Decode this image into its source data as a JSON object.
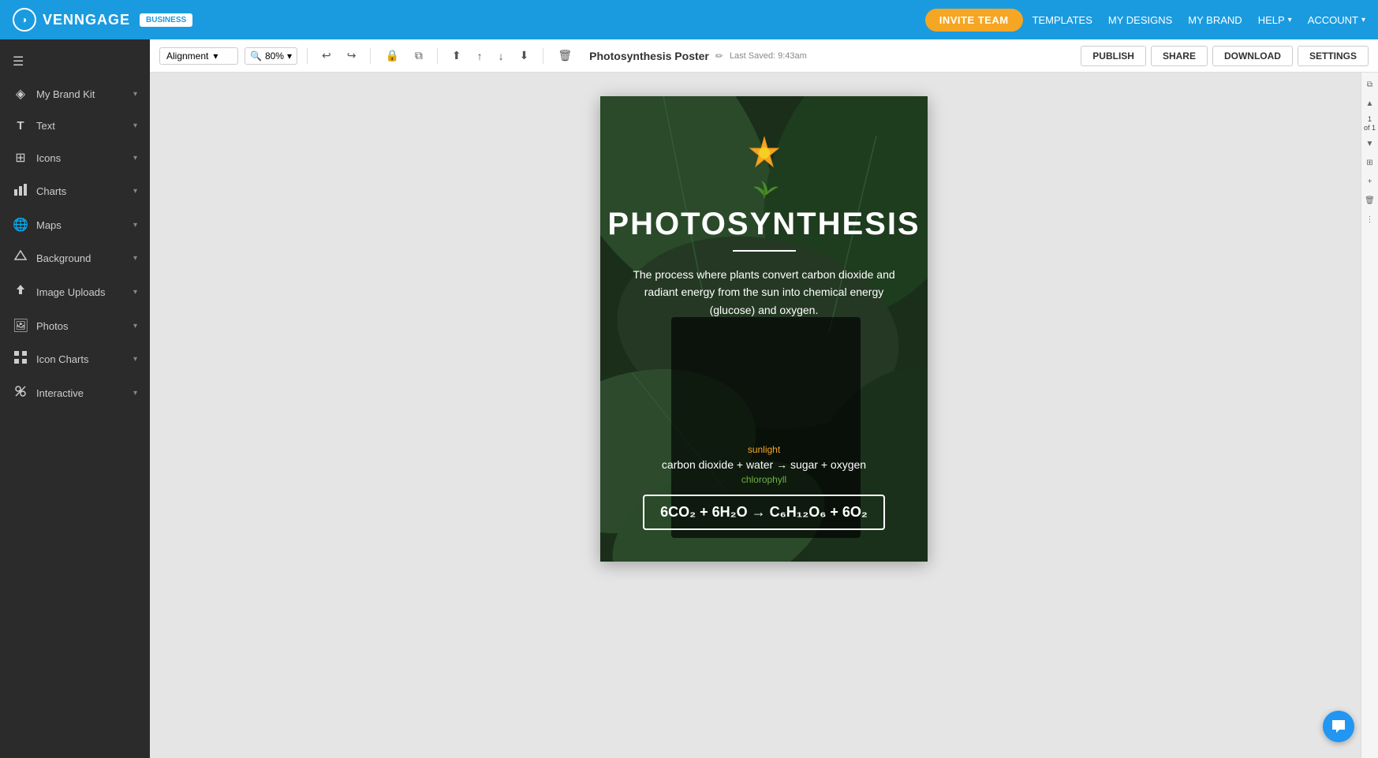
{
  "topnav": {
    "logo_text": "VENNGAGE",
    "logo_symbol": "◑",
    "business_badge": "BUSINESS",
    "invite_btn": "INVITE TEAM",
    "templates": "TEMPLATES",
    "my_designs": "MY DESIGNS",
    "my_brand": "MY BRAND",
    "help": "HELP",
    "account": "ACCOUNT"
  },
  "toolbar": {
    "alignment": "Alignment",
    "zoom": "80%",
    "doc_title": "Photosynthesis Poster",
    "last_saved": "Last Saved: 9:43am",
    "publish": "PUBLISH",
    "share": "SHARE",
    "download": "DOWNLOAD",
    "settings": "SETTINGS"
  },
  "sidebar": {
    "items": [
      {
        "id": "my-brand-kit",
        "label": "My Brand Kit",
        "icon": "◈"
      },
      {
        "id": "text",
        "label": "Text",
        "icon": "T"
      },
      {
        "id": "icons",
        "label": "Icons",
        "icon": "⊞"
      },
      {
        "id": "charts",
        "label": "Charts",
        "icon": "📊"
      },
      {
        "id": "maps",
        "label": "Maps",
        "icon": "🌐"
      },
      {
        "id": "background",
        "label": "Background",
        "icon": "⬜"
      },
      {
        "id": "image-uploads",
        "label": "Image Uploads",
        "icon": "⬆"
      },
      {
        "id": "photos",
        "label": "Photos",
        "icon": "🖼"
      },
      {
        "id": "icon-charts",
        "label": "Icon Charts",
        "icon": "⊞"
      },
      {
        "id": "interactive",
        "label": "Interactive",
        "icon": "⚙"
      }
    ]
  },
  "poster": {
    "sun": "🌟",
    "plant": "🌿",
    "title": "PHOTOSYNTHESIS",
    "description": "The process where plants convert carbon dioxide and radiant energy from the sun into chemical energy (glucose) and oxygen.",
    "sunlight": "sunlight",
    "chemical_eq": "carbon dioxide + water → sugar + oxygen",
    "chlorophyll": "chlorophyll",
    "formula": "6CO₂ + 6H₂O → C₆H₁₂O₆ + 6O₂"
  },
  "right_panel": {
    "page_num": "1",
    "page_of": "of 1"
  },
  "colors": {
    "primary_blue": "#1a9be0",
    "invite_orange": "#f5a623",
    "sidebar_dark": "#2b2b2b",
    "poster_bg": "#1a2e1a",
    "sunlight_color": "#f5a623",
    "chlorophyll_color": "#6db33f"
  }
}
